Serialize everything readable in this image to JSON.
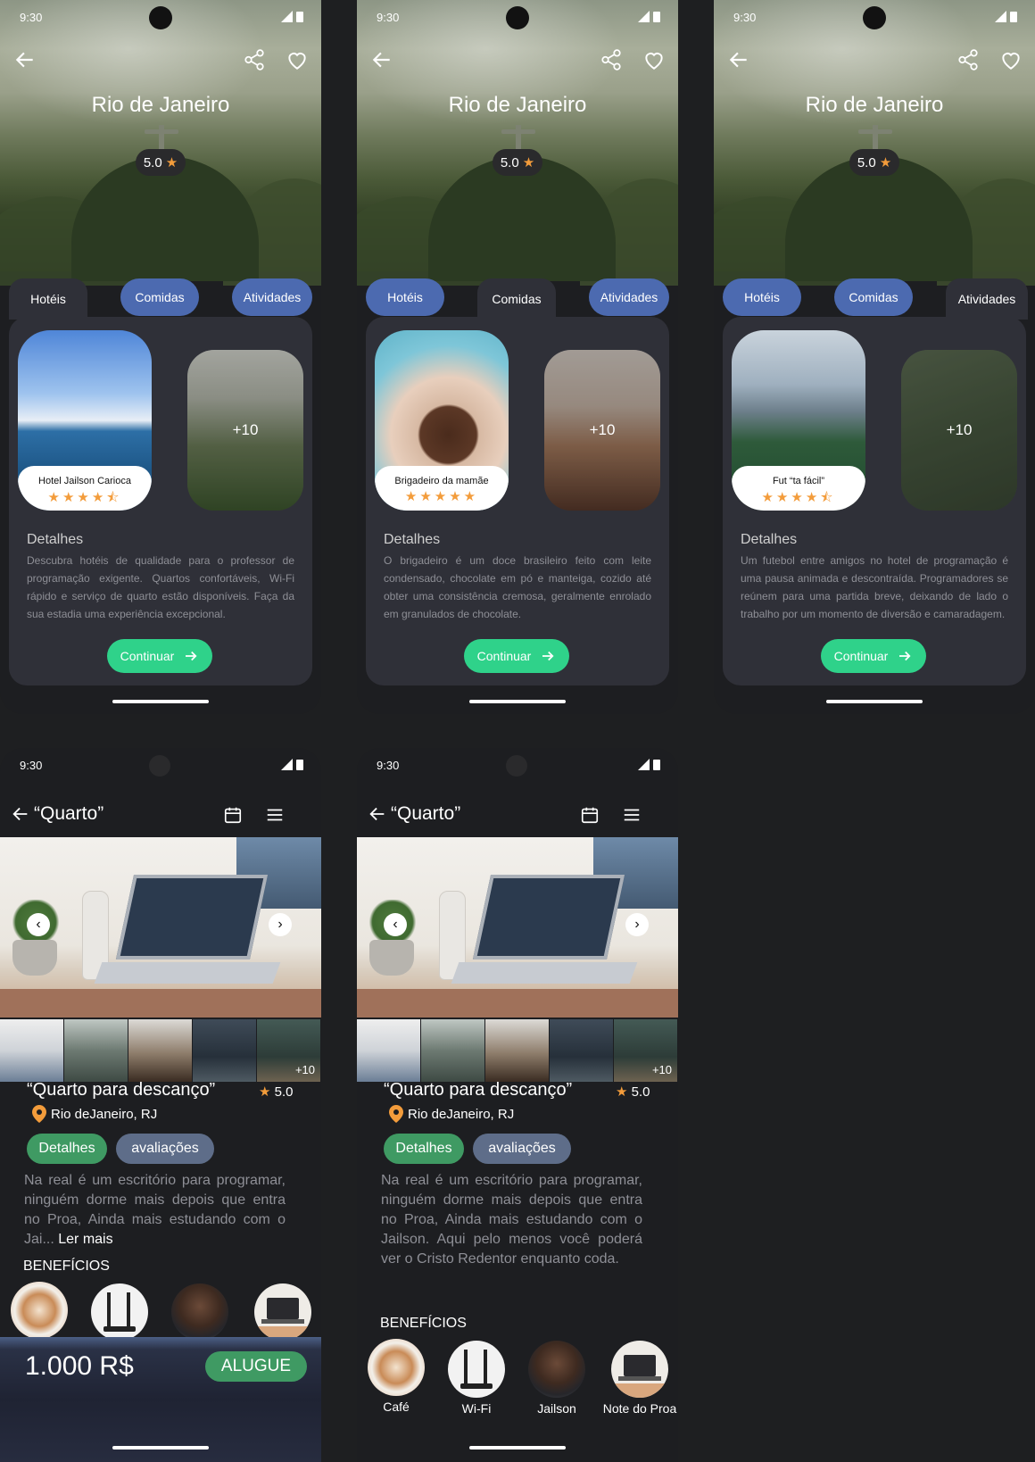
{
  "status": {
    "time": "9:30"
  },
  "destination": {
    "title": "Rio de Janeiro",
    "rating": "5.0",
    "tabs": [
      "Hotéis",
      "Comidas",
      "Atividades"
    ],
    "details_title": "Detalhes",
    "continue_label": "Continuar",
    "more_count": "+10",
    "screens": [
      {
        "active_tab": "Hotéis",
        "item_name": "Hotel Jailson Carioca",
        "stars": 4.5,
        "details": "Descubra hotéis de qualidade para o professor de programação exigente. Quartos confortáveis, Wi-Fi rápido e serviço de quarto estão disponíveis. Faça da sua estadia uma experiência excepcional."
      },
      {
        "active_tab": "Comidas",
        "item_name": "Brigadeiro da mamãe",
        "stars": 5,
        "details": "O brigadeiro é um doce brasileiro feito com leite condensado, chocolate em pó e manteiga, cozido até obter uma consistência cremosa, geralmente enrolado em granulados de chocolate."
      },
      {
        "active_tab": "Atividades",
        "item_name": "Fut “ta fácil”",
        "stars": 4.5,
        "details": "Um futebol entre amigos no hotel de programação é uma pausa animada e descontraída. Programadores se reúnem para uma partida breve, deixando de lado o trabalho por um momento de diversão e camaradagem."
      }
    ]
  },
  "room": {
    "header_title": "“Quarto”",
    "title": "“Quarto para descanço”",
    "rating": "5.0",
    "location": "Rio deJaneiro, RJ",
    "chips": [
      "Detalhes",
      "avaliações"
    ],
    "thumb_more": "+10",
    "desc_short": "Na real é um escritório para programar, ninguém dorme mais depois que entra no Proa, Ainda mais estudando com o Jai...",
    "read_more": "Ler mais",
    "desc_full": "Na real é um escritório para programar, ninguém dorme mais depois que entra no Proa, Ainda mais estudando com o Jailson. Aqui pelo menos você poderá ver o Cristo Redentor enquanto coda.",
    "benefits_title": "BENEFÍCIOS",
    "benefits": [
      "Café",
      "Wi-Fi",
      "Jailson",
      "Note do Proa"
    ],
    "price": "1.000 R$",
    "rent_label": "ALUGUE"
  },
  "colors": {
    "accent_green": "#2fd28a",
    "tab_blue": "#4c6ab0",
    "star": "#f39c3b",
    "panel": "#2f3038"
  }
}
